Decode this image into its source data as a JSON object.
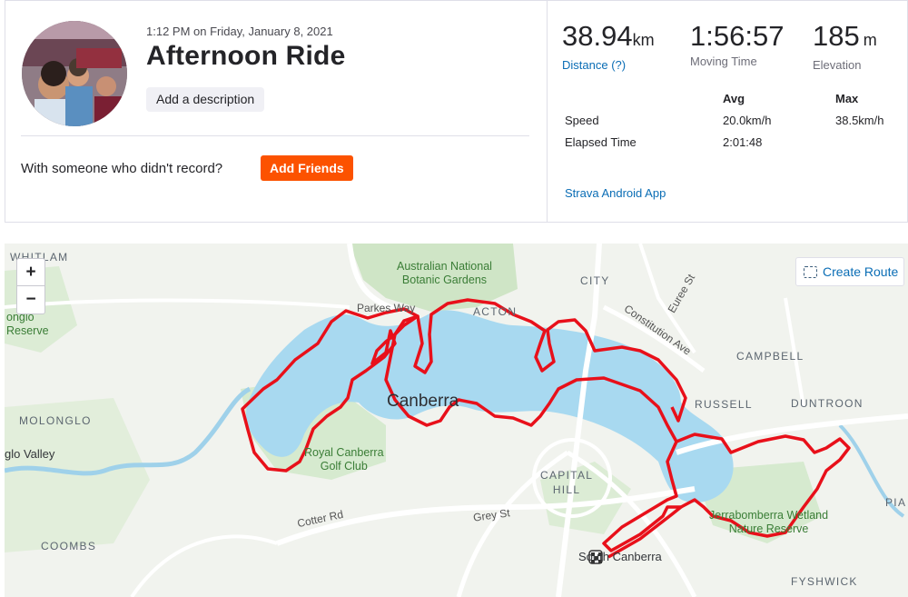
{
  "activity": {
    "datetime": "1:12 PM on Friday, January 8, 2021",
    "title": "Afternoon Ride",
    "add_description_label": "Add a description",
    "with_someone_text": "With someone who didn't record?",
    "add_friends_label": "Add Friends"
  },
  "stats": {
    "distance": {
      "value": "38.94",
      "unit": "km",
      "label": "Distance (?)"
    },
    "moving_time": {
      "value": "1:56:57",
      "label": "Moving Time"
    },
    "elevation": {
      "value": "185",
      "unit": "m",
      "label": "Elevation"
    }
  },
  "table": {
    "headers": {
      "avg": "Avg",
      "max": "Max"
    },
    "rows": [
      {
        "label": "Speed",
        "avg": "20.0km/h",
        "max": "38.5km/h"
      },
      {
        "label": "Elapsed Time",
        "avg": "2:01:48",
        "max": ""
      }
    ]
  },
  "device": "Strava Android App",
  "map": {
    "create_route_label": "Create Route",
    "zoom_in": "+",
    "zoom_out": "−",
    "labels": {
      "whitlam": "WHITLAM",
      "molonglo_reserve": "onglo\nReserve",
      "australian_national_botanic_gardens": "Australian National\nBotanic Gardens",
      "city": "CITY",
      "euree_st": "Euree St",
      "parkes_way": "Parkes Way",
      "acton": "ACTON",
      "constitution_ave": "Constitution Ave",
      "campbell": "CAMPBELL",
      "canberra": "Canberra",
      "russell": "RUSSELL",
      "duntroon": "DUNTROON",
      "molonglo": "MOLONGLO",
      "royal_canberra_golf_club": "Royal Canberra\nGolf Club",
      "capital_hill": "CAPITAL\nHILL",
      "glo_valley": "glo Valley",
      "cotter_rd": "Cotter Rd",
      "grey_st": "Grey St",
      "jerrabomberra": "Jerrabomberra Wetland\nNature Reserve",
      "coombs": "COOMBS",
      "south_canberra": "South Canberra",
      "fyshwick": "FYSHWICK",
      "pia": "PIA"
    },
    "route_color": "#e8101a",
    "water_color": "#aadaf0",
    "park_color": "#d9ecd3"
  }
}
